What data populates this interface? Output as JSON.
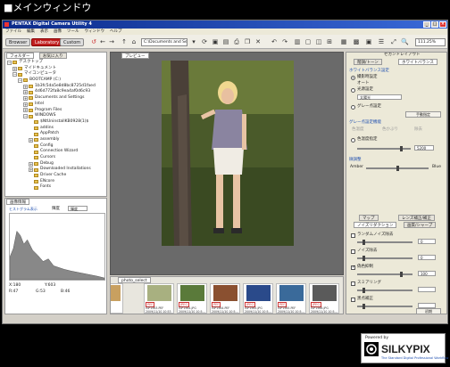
{
  "heading": "■メインウィンドウ",
  "window": {
    "title": "PENTAX Digital Camera Utility 4",
    "btn_min": "_",
    "btn_max": "□",
    "btn_close": "×"
  },
  "menu": [
    "ファイル",
    "編集",
    "表示",
    "画像",
    "ツール",
    "ウィンドウ",
    "ヘルプ"
  ],
  "toolbar": {
    "browser": "Browser",
    "laboratory": "Laboratory",
    "custom": "Custom",
    "path": "C:\\Documents and Setti",
    "zoom": "111.25%"
  },
  "left_panel": {
    "tabs": [
      "フォルダー",
      "お気に入り"
    ],
    "tree": [
      {
        "label": "デスクトップ",
        "indent": 0,
        "exp": "−"
      },
      {
        "label": "マイドキュメント",
        "indent": 1,
        "exp": "+"
      },
      {
        "label": "マイコンピュータ",
        "indent": 1,
        "exp": "−"
      },
      {
        "label": "BOOTCAMP (C:)",
        "indent": 2,
        "exp": "−"
      },
      {
        "label": "1b3fc5da5e8d8bc8725d1faed",
        "indent": 3,
        "exp": "+"
      },
      {
        "label": "4d6d772fa8c9ea4af0d6c93",
        "indent": 3,
        "exp": "+"
      },
      {
        "label": "Documents and Settings",
        "indent": 3,
        "exp": "+"
      },
      {
        "label": "Intel",
        "indent": 3,
        "exp": "+"
      },
      {
        "label": "Program Files",
        "indent": 3,
        "exp": "+"
      },
      {
        "label": "WINDOWS",
        "indent": 3,
        "exp": "−"
      },
      {
        "label": "$NtUninstallKB0928(1)$",
        "indent": 4,
        "exp": ""
      },
      {
        "label": "addins",
        "indent": 4,
        "exp": ""
      },
      {
        "label": "AppPatch",
        "indent": 4,
        "exp": ""
      },
      {
        "label": "assembly",
        "indent": 4,
        "exp": "+"
      },
      {
        "label": "Config",
        "indent": 4,
        "exp": ""
      },
      {
        "label": "Connection Wizard",
        "indent": 4,
        "exp": ""
      },
      {
        "label": "Cursors",
        "indent": 4,
        "exp": ""
      },
      {
        "label": "Debug",
        "indent": 4,
        "exp": "+"
      },
      {
        "label": "Downloaded Installations",
        "indent": 4,
        "exp": "+"
      },
      {
        "label": "Driver Cache",
        "indent": 4,
        "exp": ""
      },
      {
        "label": "ENcore",
        "indent": 4,
        "exp": ""
      },
      {
        "label": "Fonts",
        "indent": 4,
        "exp": ""
      }
    ]
  },
  "histogram_panel": {
    "tab": "画像情報",
    "channel_label": "輝度",
    "channel": "輝度",
    "hist_label": "ヒストグラム表示",
    "r_val": "X:180",
    "g_val": "Y:603",
    "r": "R:47",
    "g": "G:53",
    "b": "B:46"
  },
  "main": {
    "tab": "プレビュー"
  },
  "filmstrip": {
    "tab": "photo_select",
    "items": [
      {
        "fmt": "",
        "name": "…",
        "color": "#c8a060"
      },
      {
        "fmt": "PEF",
        "name": "IGP1963.PEF\n2009/11/10 10:53",
        "color": "#a8b080"
      },
      {
        "fmt": "JPEG",
        "name": "IGP1964.JPG\n2009/11/10 10:5…",
        "color": "#5a7a3a"
      },
      {
        "fmt": "PEF",
        "name": "IGP1964.PEF\n2009/11/10 10:5…",
        "color": "#8a5030"
      },
      {
        "fmt": "JPEG",
        "name": "IGP1965.JPG\n2009/11/10 10:5…",
        "color": "#2a4a8a"
      },
      {
        "fmt": "PEF",
        "name": "IGP1965.PEF\n2009/11/10 10:5…",
        "color": "#3a6a9a"
      },
      {
        "fmt": "JPEG",
        "name": "IGP1966.JPG\n2009/11/10 10:5…",
        "color": "#5a5a5a"
      }
    ]
  },
  "right_panel": {
    "top_tab": "セカンドレイアウト",
    "tabs": [
      "階調/トーン",
      "ホワイトバランス"
    ],
    "wb_title": "ホワイトバランス設定",
    "opt_camera": "撮影時設定",
    "opt_auto": "オート",
    "opt_preset": "光源設定",
    "preset_value": "太陽光",
    "opt_gray": "グレー点設定",
    "gray_btn": "手動指定",
    "gray_caption": "グレー点設定機能",
    "gray_labels": [
      "色温度",
      "色かぶり",
      "除去"
    ],
    "opt_temp": "色温度指定",
    "temp_value": "5200",
    "fine_label": "微調整",
    "fine_left": "Amber",
    "fine_right": "Blue",
    "tabs2": [
      "マップ",
      "レンズ補正/補正"
    ],
    "tabs3": [
      "ノイズリダクション",
      "画質/シャープ"
    ],
    "rows": [
      {
        "label": "ランダムノイズ除去",
        "checked": false,
        "value": "0"
      },
      {
        "label": "ノイズ除去",
        "checked": false,
        "value": "0"
      },
      {
        "label": "偽色抑制",
        "checked": true,
        "value": "100"
      },
      {
        "label": "スミアリング",
        "checked": false,
        "value": ""
      },
      {
        "label": "黒点補正",
        "checked": false,
        "value": ""
      }
    ],
    "reset_label": "初期"
  },
  "logo": {
    "powered": "Powered by",
    "brand": "SILKYPIX",
    "tagline": "The Standard Digital Professional Workflow"
  }
}
